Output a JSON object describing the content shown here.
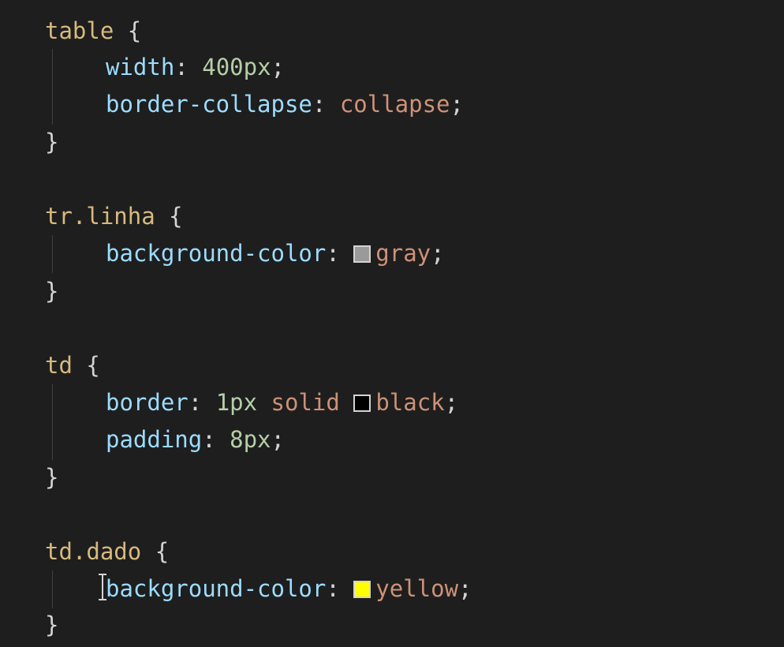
{
  "rules": [
    {
      "selector": "table",
      "open": "{",
      "close": "}",
      "decls": [
        {
          "prop": "width",
          "value_num": "400px",
          "end": ";"
        },
        {
          "prop": "border-collapse",
          "value": "collapse",
          "end": ";"
        }
      ]
    },
    {
      "selector": "tr.linha",
      "open": "{",
      "close": "}",
      "decls": [
        {
          "prop": "background-color",
          "value": "gray",
          "swatch": "#9a9a9a",
          "end": ";"
        }
      ]
    },
    {
      "selector": "td",
      "open": "{",
      "close": "}",
      "decls": [
        {
          "prop": "border",
          "value_num": "1px",
          "value": "solid",
          "value2": "black",
          "swatch": "#000000",
          "end": ";"
        },
        {
          "prop": "padding",
          "value_num": "8px",
          "end": ";"
        }
      ]
    },
    {
      "selector": "td.dado",
      "open": "{",
      "close": "}",
      "decls": [
        {
          "prop": "background-color",
          "value": "yellow",
          "swatch": "#ffff00",
          "end": ";"
        }
      ]
    }
  ],
  "colors": {
    "background": "#1e1e1e",
    "selector": "#d7ba7d",
    "property": "#9cdcfe",
    "number": "#b5cea8",
    "string_value": "#ce9178"
  }
}
